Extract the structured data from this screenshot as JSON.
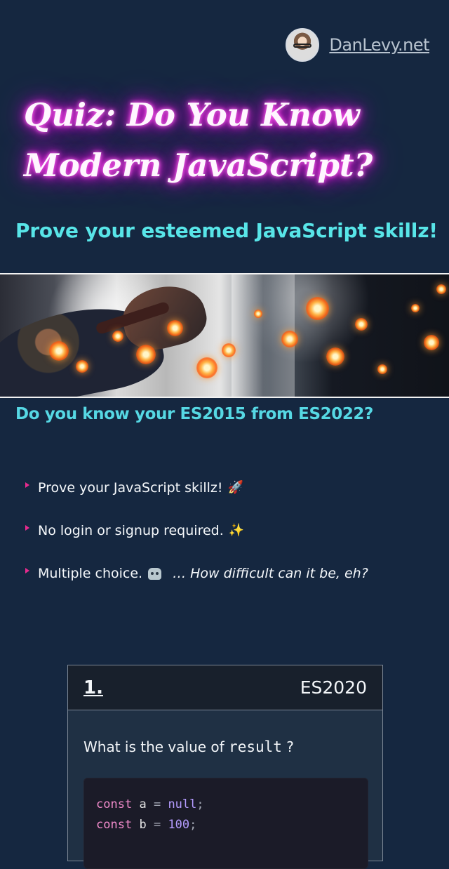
{
  "header": {
    "site_link": "DanLevy.net"
  },
  "hero": {
    "title": "Quiz: Do You Know Modern JavaScript?",
    "subtitle": "Prove your esteemed JavaScript skillz!"
  },
  "intro": {
    "heading": "Do you know your ES2015 from ES2022?",
    "items": [
      {
        "text": "Prove your JavaScript skillz!",
        "emoji": "🚀"
      },
      {
        "text": "No login or signup required.",
        "emoji": "✨"
      },
      {
        "text": "Multiple choice.",
        "tail": "… How difficult can it be, eh?"
      }
    ]
  },
  "question": {
    "number": "1.",
    "tag": "ES2020",
    "prompt_prefix": "What is the value of",
    "prompt_code": "result",
    "prompt_suffix": "?",
    "code_lines": [
      {
        "keyword": "const",
        "name": "a",
        "operator": "=",
        "value": "null",
        "end": ";"
      },
      {
        "keyword": "const",
        "name": "b",
        "operator": "=",
        "value": "100",
        "end": ";"
      }
    ]
  }
}
